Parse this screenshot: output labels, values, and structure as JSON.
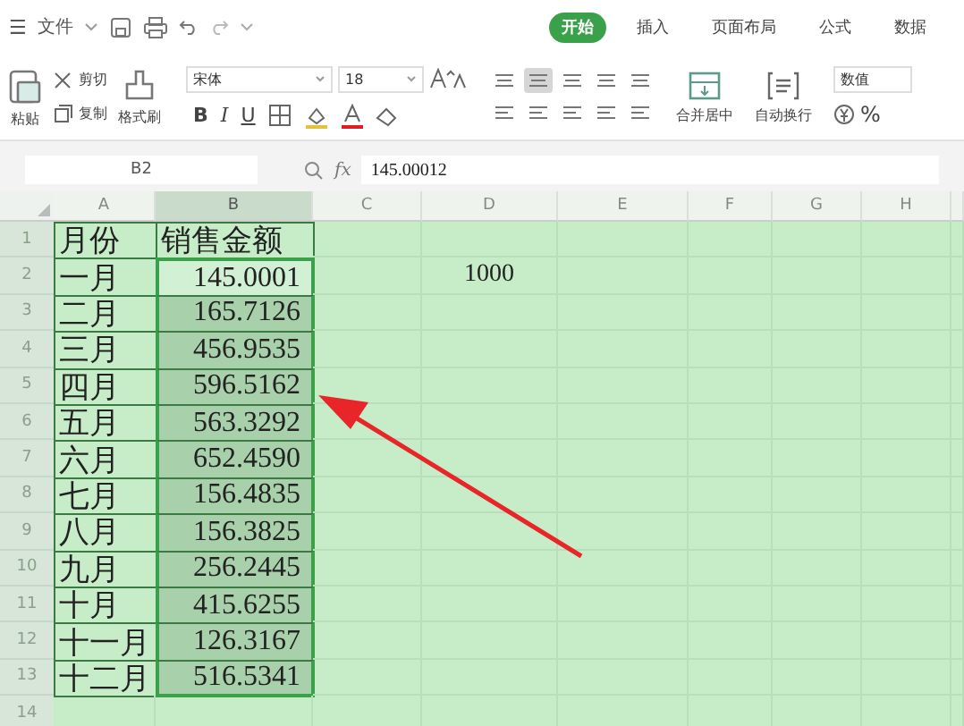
{
  "menu": {
    "icon": "☰",
    "file": "文件"
  },
  "tabs": [
    {
      "label": "开始",
      "selected": true
    },
    {
      "label": "插入",
      "selected": false
    },
    {
      "label": "页面布局",
      "selected": false
    },
    {
      "label": "公式",
      "selected": false
    },
    {
      "label": "数据",
      "selected": false
    }
  ],
  "ribbon": {
    "paste": "粘贴",
    "cut": "剪切",
    "copy": "复制",
    "format_painter": "格式刷",
    "font": "宋体",
    "font_size": "18",
    "bold": "B",
    "italic": "I",
    "underline": "U",
    "merge": "合并居中",
    "wrap": "自动换行",
    "number_format": "数值",
    "percent": "%"
  },
  "formula_bar": {
    "name_box": "B2",
    "fx": "fx",
    "formula": "145.00012"
  },
  "columns": [
    {
      "label": "A",
      "selected": false
    },
    {
      "label": "B",
      "selected": true
    },
    {
      "label": "C",
      "selected": false
    },
    {
      "label": "D",
      "selected": false
    },
    {
      "label": "E",
      "selected": false
    },
    {
      "label": "F",
      "selected": false
    },
    {
      "label": "G",
      "selected": false
    },
    {
      "label": "H",
      "selected": false
    }
  ],
  "rows": [
    {
      "number": "1",
      "month": "月份",
      "amount": "销售金额",
      "selected": false,
      "active": false
    },
    {
      "number": "2",
      "month": "一月",
      "amount": "145.0001",
      "column_d": "1000",
      "selected": true,
      "active": true
    },
    {
      "number": "3",
      "month": "二月",
      "amount": "165.7126",
      "selected": true,
      "active": false
    },
    {
      "number": "4",
      "month": "三月",
      "amount": "456.9535",
      "selected": true,
      "active": false
    },
    {
      "number": "5",
      "month": "四月",
      "amount": "596.5162",
      "selected": true,
      "active": false
    },
    {
      "number": "6",
      "month": "五月",
      "amount": "563.3292",
      "selected": true,
      "active": false
    },
    {
      "number": "7",
      "month": "六月",
      "amount": "652.4590",
      "selected": true,
      "active": false
    },
    {
      "number": "8",
      "month": "七月",
      "amount": "156.4835",
      "selected": true,
      "active": false
    },
    {
      "number": "9",
      "month": "八月",
      "amount": "156.3825",
      "selected": true,
      "active": false
    },
    {
      "number": "10",
      "month": "九月",
      "amount": "256.2445",
      "selected": true,
      "active": false
    },
    {
      "number": "11",
      "month": "十月",
      "amount": "415.6255",
      "selected": true,
      "active": false
    },
    {
      "number": "12",
      "month": "十一月",
      "amount": "126.3167",
      "selected": true,
      "active": false
    },
    {
      "number": "13",
      "month": "十二月",
      "amount": "516.5341",
      "selected": true,
      "active": false
    },
    {
      "number": "14"
    }
  ]
}
